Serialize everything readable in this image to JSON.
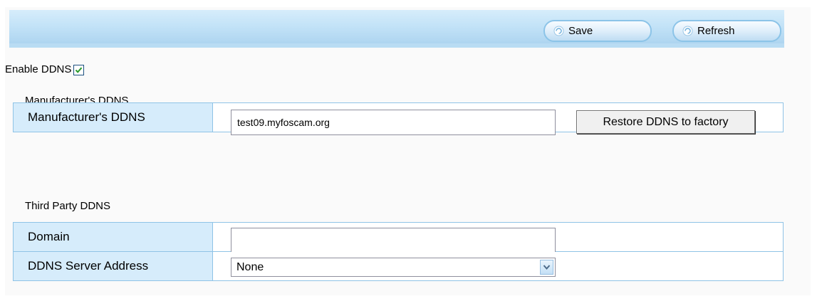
{
  "toolbar": {
    "save_label": "Save",
    "refresh_label": "Refresh",
    "save_icon": "refresh-circle-icon",
    "refresh_icon": "refresh-circle-icon"
  },
  "enable_ddns": {
    "label": "Enable DDNS",
    "checked": true
  },
  "manufacturer_section": {
    "title": "Manufacturer's DDNS",
    "row_label": "Manufacturer's DDNS",
    "value": "test09.myfoscam.org",
    "restore_button_label": "Restore DDNS to factory"
  },
  "third_party_section": {
    "title": "Third Party DDNS",
    "domain_label": "Domain",
    "domain_value": "",
    "server_label": "DDNS Server Address",
    "server_selected": "None"
  },
  "colors": {
    "toolbar_blue": "#c2e2f7",
    "label_cell_blue": "#d6ecfb",
    "border_blue": "#8fc3e6",
    "checkbox_check_green": "#2a9a2a"
  }
}
